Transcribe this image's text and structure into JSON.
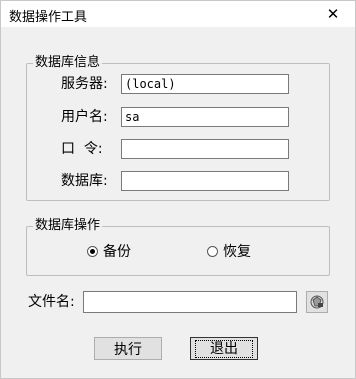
{
  "window": {
    "title": "数据操作工具",
    "close_label": "✕"
  },
  "db_info": {
    "title": "数据库信息",
    "server_label": "服务器:",
    "server_value": "(local)",
    "user_label": "用户名:",
    "user_value": "sa",
    "password_label": "口  令:",
    "password_value": "",
    "database_label": "数据库:",
    "database_value": ""
  },
  "db_ops": {
    "title": "数据库操作",
    "backup_label": "备份",
    "restore_label": "恢复",
    "selected": "backup"
  },
  "file": {
    "label": "文件名:",
    "value": "",
    "browse_icon": "folder-browse-icon"
  },
  "buttons": {
    "execute": "执行",
    "exit": "退出"
  }
}
